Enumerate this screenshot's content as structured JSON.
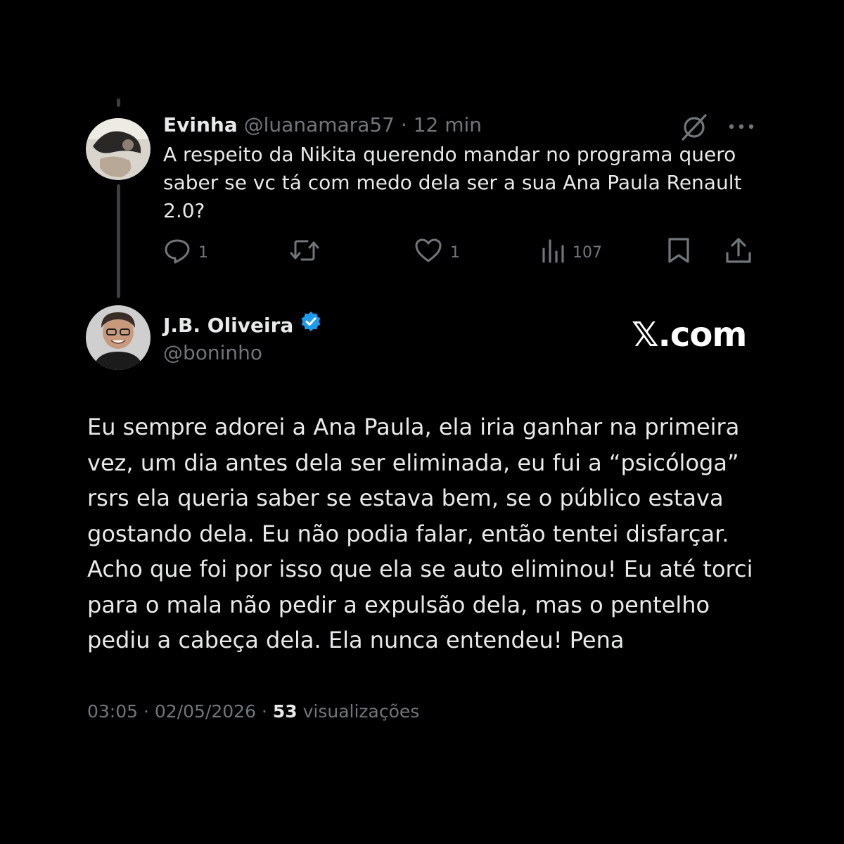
{
  "reply": {
    "display_name": "Evinha",
    "handle": "@luanamara57",
    "separator": "·",
    "time": "12 min",
    "text": "A respeito da Nikita querendo mandar no programa quero saber se vc tá com medo dela ser a sua Ana Paula Renault 2.0?",
    "actions": {
      "replies": "1",
      "reposts": "",
      "likes": "1",
      "views": "107"
    }
  },
  "post": {
    "display_name": "J.B. Oliveira",
    "handle": "@boninho",
    "verified": true,
    "text": "Eu sempre adorei a Ana Paula, ela iria ganhar na primeira vez, um dia antes dela ser eliminada, eu fui a “psicóloga” rsrs ela queria saber se estava bem, se o público estava gostando dela. Eu não podia falar, então tentei disfarçar. Acho que foi por isso que ela se auto eliminou! Eu até torci para o mala não pedir a expulsão dela, mas o pentelho pediu a cabeça dela. Ela nunca entendeu! Pena",
    "time": "03:05",
    "date": "02/05/2026",
    "separator": "·",
    "views_count": "53",
    "views_label": "visualizações"
  },
  "watermark": "𝕏.com",
  "colors": {
    "background": "#000000",
    "text": "#e7e9ea",
    "muted": "#71767b",
    "verified": "#1d9bf0",
    "thread_line": "#3c3f41"
  },
  "icons": [
    "reply-icon",
    "repost-icon",
    "like-icon",
    "views-icon",
    "bookmark-icon",
    "share-icon",
    "grok-icon",
    "more-icon",
    "verified-badge-icon"
  ]
}
